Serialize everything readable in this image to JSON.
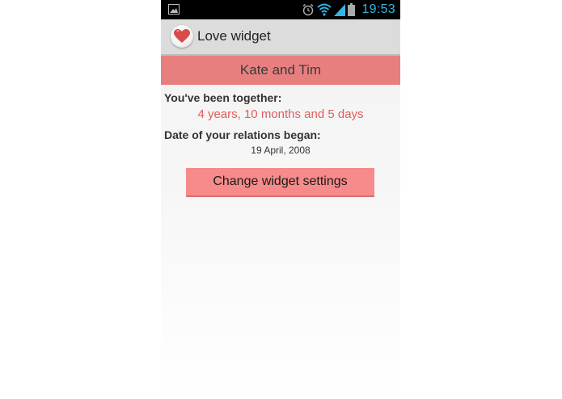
{
  "status_bar": {
    "time": "19:53",
    "icons": [
      "gallery-icon",
      "alarm-icon",
      "wifi-icon",
      "signal-icon",
      "battery-icon"
    ],
    "time_color": "#33b5e5"
  },
  "action_bar": {
    "title": "Love widget",
    "icon": "heart-icon"
  },
  "names": "Kate and Tim",
  "together": {
    "label": "You've been together:",
    "value": "4 years, 10 months and 5 days"
  },
  "began": {
    "label": "Date of your relations began:",
    "value": "19 April, 2008"
  },
  "settings_button": "Change widget settings",
  "colors": {
    "banner": "#e87f7f",
    "accent_text": "#e05c5c",
    "button": "#f78a8a"
  }
}
